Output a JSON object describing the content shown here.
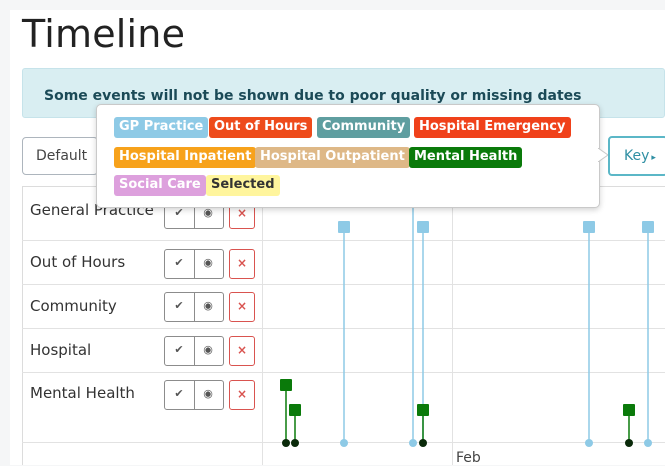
{
  "page": {
    "title": "Timeline"
  },
  "alert": {
    "text": "Some events will not be shown due to poor quality or missing dates"
  },
  "toolbar": {
    "default_label": "Default",
    "key_label": "Key",
    "key_chevron": "▸"
  },
  "rows": [
    {
      "label": "General Practice",
      "shortcut_glyph": "✔",
      "view_glyph": "◉",
      "remove_glyph": "×"
    },
    {
      "label": "Out of Hours",
      "shortcut_glyph": "✔",
      "view_glyph": "◉",
      "remove_glyph": "×"
    },
    {
      "label": "Community",
      "shortcut_glyph": "✔",
      "view_glyph": "◉",
      "remove_glyph": "×"
    },
    {
      "label": "Hospital",
      "shortcut_glyph": "✔",
      "view_glyph": "◉",
      "remove_glyph": "×"
    },
    {
      "label": "Mental Health",
      "shortcut_glyph": "✔",
      "view_glyph": "◉",
      "remove_glyph": "×"
    }
  ],
  "axis": {
    "month_label": "Feb"
  },
  "key": {
    "items": [
      {
        "label": "GP Practice",
        "color": "#8ecae6",
        "text_color": "#ffffff"
      },
      {
        "label": "Out of Hours",
        "color": "#ee4b1b",
        "text_color": "#ffffff"
      },
      {
        "label": "Community",
        "color": "#5f9ea0",
        "text_color": "#ffffff"
      },
      {
        "label": "Hospital Emergency",
        "color": "#f0411a",
        "text_color": "#ffffff"
      },
      {
        "label": "Hospital Inpatient",
        "color": "#f7a21b",
        "text_color": "#ffffff"
      },
      {
        "label": "Hospital Outpatient",
        "color": "#deb887",
        "text_color": "#ffffff"
      },
      {
        "label": "Mental Health",
        "color": "#0a7a0a",
        "text_color": "#ffffff"
      },
      {
        "label": "Social Care",
        "color": "#dda0dd",
        "text_color": "#ffffff"
      },
      {
        "label": "Selected",
        "color": "#fff59d",
        "text_color": "#333333"
      }
    ]
  },
  "colors": {
    "gp_event": "#8ecae6",
    "mental_health_event": "#0a7a0a"
  }
}
